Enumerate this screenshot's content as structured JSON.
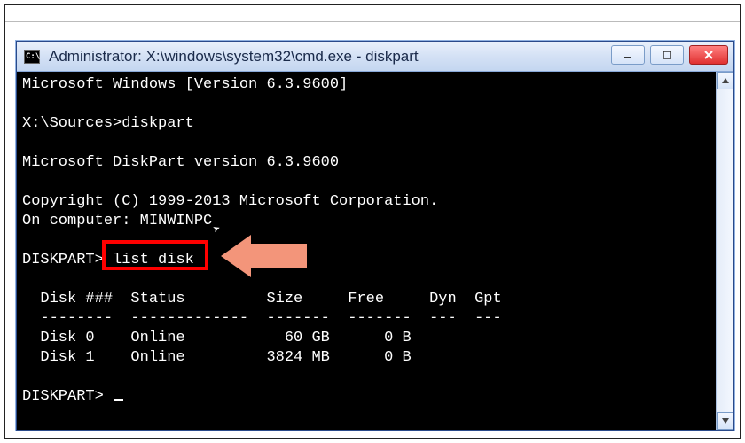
{
  "window": {
    "title": "Administrator: X:\\windows\\system32\\cmd.exe - diskpart",
    "icon_text": "C:\\"
  },
  "terminal": {
    "line_version": "Microsoft Windows [Version 6.3.9600]",
    "blank": "",
    "prompt1_prefix": "X:\\Sources>",
    "prompt1_cmd": "diskpart",
    "diskpart_version": "Microsoft DiskPart version 6.3.9600",
    "copyright": "Copyright (C) 1999-2013 Microsoft Corporation.",
    "computer": "On computer: MINWINPC",
    "prompt2_prefix": "DISKPART> ",
    "prompt2_cmd": "list disk",
    "header": "  Disk ###  Status         Size     Free     Dyn  Gpt",
    "divider": "  --------  -------------  -------  -------  ---  ---",
    "row0": "  Disk 0    Online           60 GB      0 B",
    "row1": "  Disk 1    Online         3824 MB      0 B",
    "prompt3_prefix": "DISKPART> "
  },
  "chart_data": {
    "type": "table",
    "title": "diskpart list disk",
    "columns": [
      "Disk ###",
      "Status",
      "Size",
      "Free",
      "Dyn",
      "Gpt"
    ],
    "rows": [
      {
        "Disk ###": "Disk 0",
        "Status": "Online",
        "Size": "60 GB",
        "Free": "0 B",
        "Dyn": "",
        "Gpt": ""
      },
      {
        "Disk ###": "Disk 1",
        "Status": "Online",
        "Size": "3824 MB",
        "Free": "0 B",
        "Dyn": "",
        "Gpt": ""
      }
    ]
  },
  "annotation": {
    "highlighted_command": "list disk"
  }
}
